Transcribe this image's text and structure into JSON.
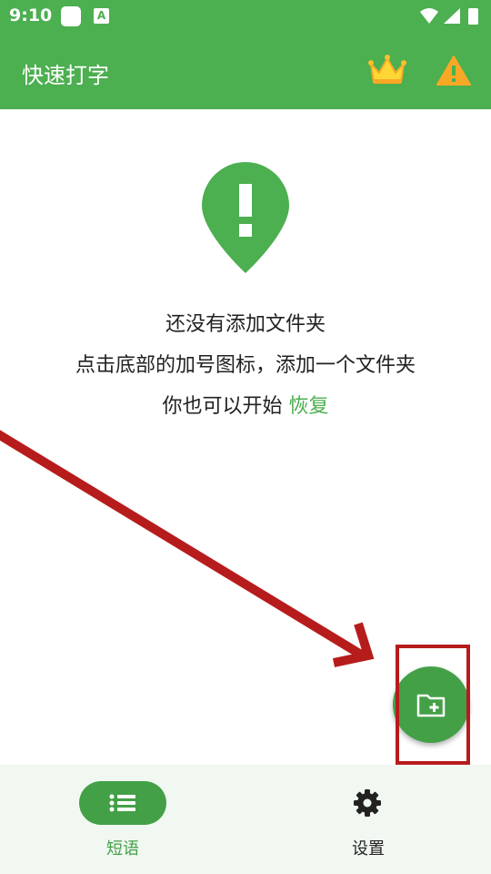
{
  "status_bar": {
    "time": "9:10",
    "notification_icons": [
      "square-app-icon",
      "a-icon"
    ],
    "system_icons": [
      "wifi-icon",
      "signal-icon",
      "battery-icon"
    ],
    "a_icon_letter": "A"
  },
  "app_bar": {
    "title": "快速打字",
    "actions": [
      "crown-icon",
      "warning-icon"
    ]
  },
  "empty_state": {
    "line1": "还没有添加文件夹",
    "line2": "点击底部的加号图标，添加一个文件夹",
    "line3_prefix": "你也可以开始 ",
    "restore_link": "恢复"
  },
  "fab": {
    "icon": "add-folder-icon"
  },
  "bottom_nav": {
    "items": [
      {
        "label": "短语",
        "icon": "list-icon",
        "selected": true
      },
      {
        "label": "设置",
        "icon": "gear-icon",
        "selected": false
      }
    ]
  },
  "colors": {
    "primary": "#4caf50",
    "primary_dark": "#43a047",
    "annotation_red": "#b71c1c",
    "warning": "#f9a825",
    "crown": "#fdd835",
    "nav_background": "#f1f8f1"
  }
}
